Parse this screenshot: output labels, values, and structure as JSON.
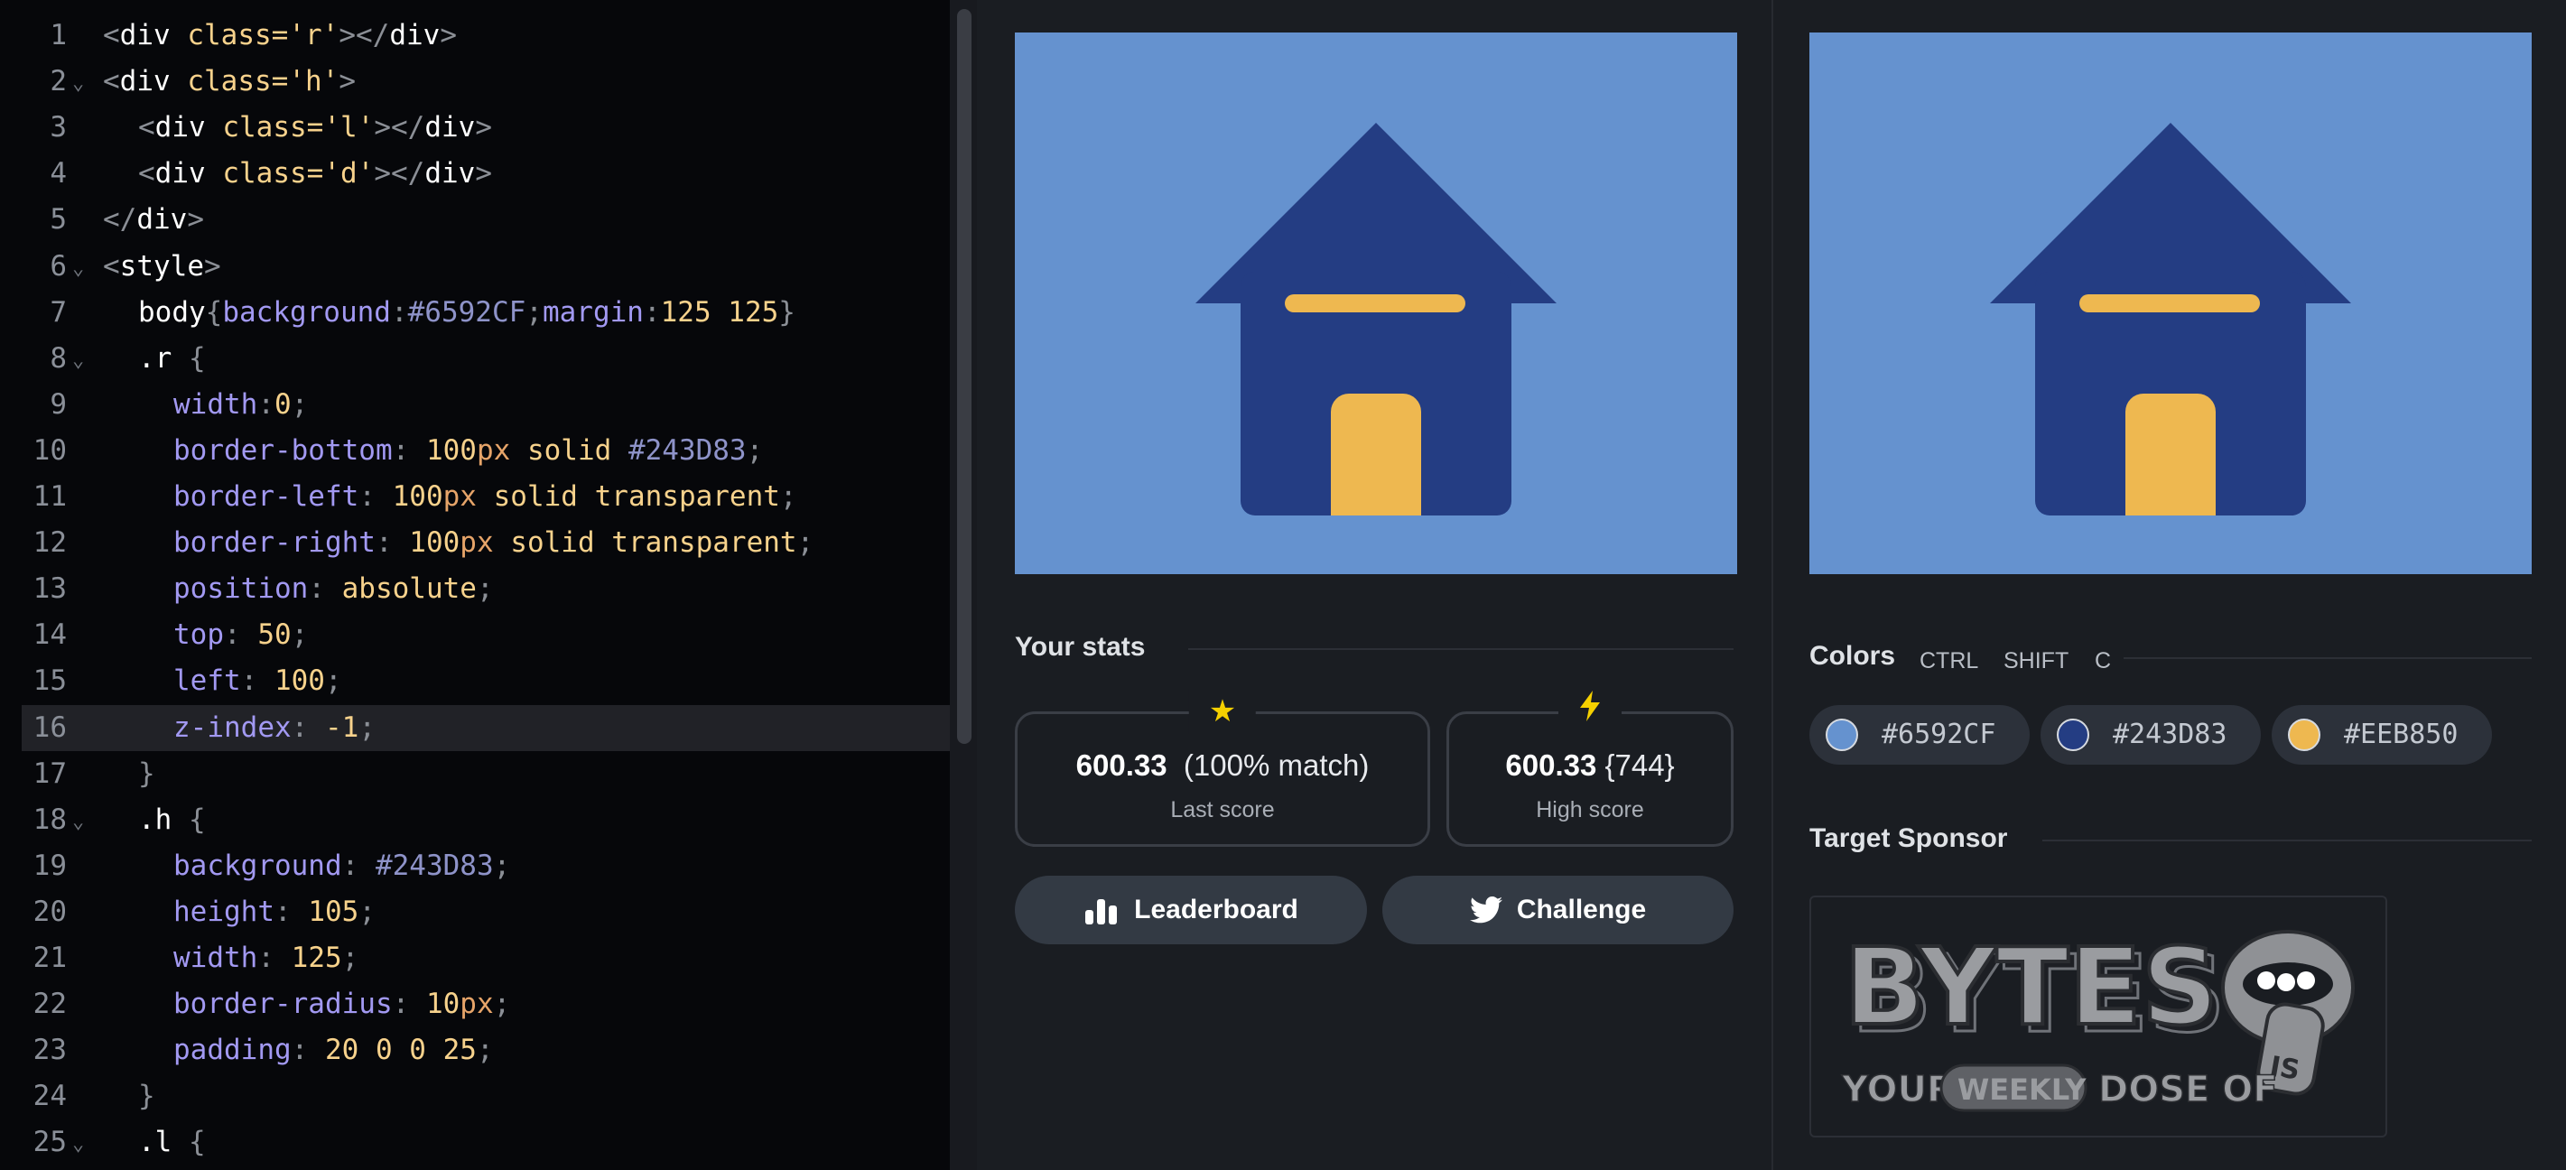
{
  "editor": {
    "active_line": 16,
    "lines": [
      {
        "n": "1",
        "fold": false,
        "indent": 0,
        "tokens": [
          [
            "g",
            "<"
          ],
          [
            "w",
            "div "
          ],
          [
            "o",
            "class="
          ],
          [
            "o",
            "'r'"
          ],
          [
            "g",
            "></"
          ],
          [
            "w",
            "div"
          ],
          [
            "g",
            ">"
          ]
        ]
      },
      {
        "n": "2",
        "fold": true,
        "indent": 0,
        "tokens": [
          [
            "g",
            "<"
          ],
          [
            "w",
            "div "
          ],
          [
            "o",
            "class="
          ],
          [
            "o",
            "'h'"
          ],
          [
            "g",
            ">"
          ]
        ]
      },
      {
        "n": "3",
        "fold": false,
        "indent": 2,
        "tokens": [
          [
            "g",
            "<"
          ],
          [
            "w",
            "div "
          ],
          [
            "o",
            "class="
          ],
          [
            "o",
            "'l'"
          ],
          [
            "g",
            "></"
          ],
          [
            "w",
            "div"
          ],
          [
            "g",
            ">"
          ]
        ]
      },
      {
        "n": "4",
        "fold": false,
        "indent": 2,
        "tokens": [
          [
            "g",
            "<"
          ],
          [
            "w",
            "div "
          ],
          [
            "o",
            "class="
          ],
          [
            "o",
            "'d'"
          ],
          [
            "g",
            "></"
          ],
          [
            "w",
            "div"
          ],
          [
            "g",
            ">"
          ]
        ]
      },
      {
        "n": "5",
        "fold": false,
        "indent": 0,
        "tokens": [
          [
            "g",
            "</"
          ],
          [
            "w",
            "div"
          ],
          [
            "g",
            ">"
          ]
        ]
      },
      {
        "n": "6",
        "fold": true,
        "indent": 0,
        "tokens": [
          [
            "g",
            "<"
          ],
          [
            "w",
            "style"
          ],
          [
            "g",
            ">"
          ]
        ]
      },
      {
        "n": "7",
        "fold": false,
        "indent": 2,
        "tokens": [
          [
            "w",
            "body"
          ],
          [
            "g",
            "{"
          ],
          [
            "p",
            "background"
          ],
          [
            "g",
            ":"
          ],
          [
            "x",
            "#6592CF"
          ],
          [
            "g",
            ";"
          ],
          [
            "p",
            "margin"
          ],
          [
            "g",
            ":"
          ],
          [
            "n",
            "125 125"
          ],
          [
            "g",
            "}"
          ]
        ]
      },
      {
        "n": "8",
        "fold": true,
        "indent": 2,
        "tokens": [
          [
            "w",
            ".r "
          ],
          [
            "g",
            "{"
          ]
        ]
      },
      {
        "n": "9",
        "fold": false,
        "indent": 4,
        "tokens": [
          [
            "p",
            "width"
          ],
          [
            "g",
            ":"
          ],
          [
            "n",
            "0"
          ],
          [
            "g",
            ";"
          ]
        ]
      },
      {
        "n": "10",
        "fold": false,
        "indent": 4,
        "tokens": [
          [
            "p",
            "border-bottom"
          ],
          [
            "g",
            ": "
          ],
          [
            "n",
            "100"
          ],
          [
            "u",
            "px"
          ],
          [
            "w",
            " "
          ],
          [
            "o",
            "solid "
          ],
          [
            "x",
            "#243D83"
          ],
          [
            "g",
            ";"
          ]
        ]
      },
      {
        "n": "11",
        "fold": false,
        "indent": 4,
        "tokens": [
          [
            "p",
            "border-left"
          ],
          [
            "g",
            ": "
          ],
          [
            "n",
            "100"
          ],
          [
            "u",
            "px"
          ],
          [
            "w",
            " "
          ],
          [
            "o",
            "solid transparent"
          ],
          [
            "g",
            ";"
          ]
        ]
      },
      {
        "n": "12",
        "fold": false,
        "indent": 4,
        "tokens": [
          [
            "p",
            "border-right"
          ],
          [
            "g",
            ": "
          ],
          [
            "n",
            "100"
          ],
          [
            "u",
            "px"
          ],
          [
            "w",
            " "
          ],
          [
            "o",
            "solid transparent"
          ],
          [
            "g",
            ";"
          ]
        ]
      },
      {
        "n": "13",
        "fold": false,
        "indent": 4,
        "tokens": [
          [
            "p",
            "position"
          ],
          [
            "g",
            ": "
          ],
          [
            "o",
            "absolute"
          ],
          [
            "g",
            ";"
          ]
        ]
      },
      {
        "n": "14",
        "fold": false,
        "indent": 4,
        "tokens": [
          [
            "p",
            "top"
          ],
          [
            "g",
            ": "
          ],
          [
            "n",
            "50"
          ],
          [
            "g",
            ";"
          ]
        ]
      },
      {
        "n": "15",
        "fold": false,
        "indent": 4,
        "tokens": [
          [
            "p",
            "left"
          ],
          [
            "g",
            ": "
          ],
          [
            "n",
            "100"
          ],
          [
            "g",
            ";"
          ]
        ]
      },
      {
        "n": "16",
        "fold": false,
        "indent": 4,
        "tokens": [
          [
            "p",
            "z-index"
          ],
          [
            "g",
            ": "
          ],
          [
            "n",
            "-1"
          ],
          [
            "g",
            ";"
          ]
        ]
      },
      {
        "n": "17",
        "fold": false,
        "indent": 2,
        "tokens": [
          [
            "g",
            "}"
          ]
        ]
      },
      {
        "n": "18",
        "fold": true,
        "indent": 2,
        "tokens": [
          [
            "w",
            ".h "
          ],
          [
            "g",
            "{"
          ]
        ]
      },
      {
        "n": "19",
        "fold": false,
        "indent": 4,
        "tokens": [
          [
            "p",
            "background"
          ],
          [
            "g",
            ": "
          ],
          [
            "x",
            "#243D83"
          ],
          [
            "g",
            ";"
          ]
        ]
      },
      {
        "n": "20",
        "fold": false,
        "indent": 4,
        "tokens": [
          [
            "p",
            "height"
          ],
          [
            "g",
            ": "
          ],
          [
            "n",
            "105"
          ],
          [
            "g",
            ";"
          ]
        ]
      },
      {
        "n": "21",
        "fold": false,
        "indent": 4,
        "tokens": [
          [
            "p",
            "width"
          ],
          [
            "g",
            ": "
          ],
          [
            "n",
            "125"
          ],
          [
            "g",
            ";"
          ]
        ]
      },
      {
        "n": "22",
        "fold": false,
        "indent": 4,
        "tokens": [
          [
            "p",
            "border-radius"
          ],
          [
            "g",
            ": "
          ],
          [
            "n",
            "10"
          ],
          [
            "u",
            "px"
          ],
          [
            "g",
            ";"
          ]
        ]
      },
      {
        "n": "23",
        "fold": false,
        "indent": 4,
        "tokens": [
          [
            "p",
            "padding"
          ],
          [
            "g",
            ": "
          ],
          [
            "n",
            "20 0 0 25"
          ],
          [
            "g",
            ";"
          ]
        ]
      },
      {
        "n": "24",
        "fold": false,
        "indent": 2,
        "tokens": [
          [
            "g",
            "}"
          ]
        ]
      },
      {
        "n": "25",
        "fold": true,
        "indent": 2,
        "tokens": [
          [
            "w",
            ".l "
          ],
          [
            "g",
            "{"
          ]
        ]
      }
    ]
  },
  "colors_used": {
    "background": "#6592CF",
    "house": "#243D83",
    "accent": "#EEB850"
  },
  "stats": {
    "title": "Your stats",
    "last": {
      "icon": "star-icon",
      "score": "600.33",
      "detail": "(100% match)",
      "label": "Last score"
    },
    "high": {
      "icon": "lightning-icon",
      "score": "600.33",
      "detail": "{744}",
      "label": "High score"
    }
  },
  "buttons": {
    "leaderboard": {
      "icon": "bar-chart-icon",
      "label": "Leaderboard"
    },
    "challenge": {
      "icon": "twitter-icon",
      "label": "Challenge"
    }
  },
  "colors_panel": {
    "title": "Colors",
    "shortcut": [
      "CTRL",
      "SHIFT",
      "C"
    ],
    "swatches": [
      {
        "hex": "#6592CF"
      },
      {
        "hex": "#243D83"
      },
      {
        "hex": "#EEB850"
      }
    ]
  },
  "sponsor": {
    "title": "Target Sponsor",
    "logo_text": "BYTES",
    "tagline": "YOUR WEEKLY DOSE OF JS"
  }
}
